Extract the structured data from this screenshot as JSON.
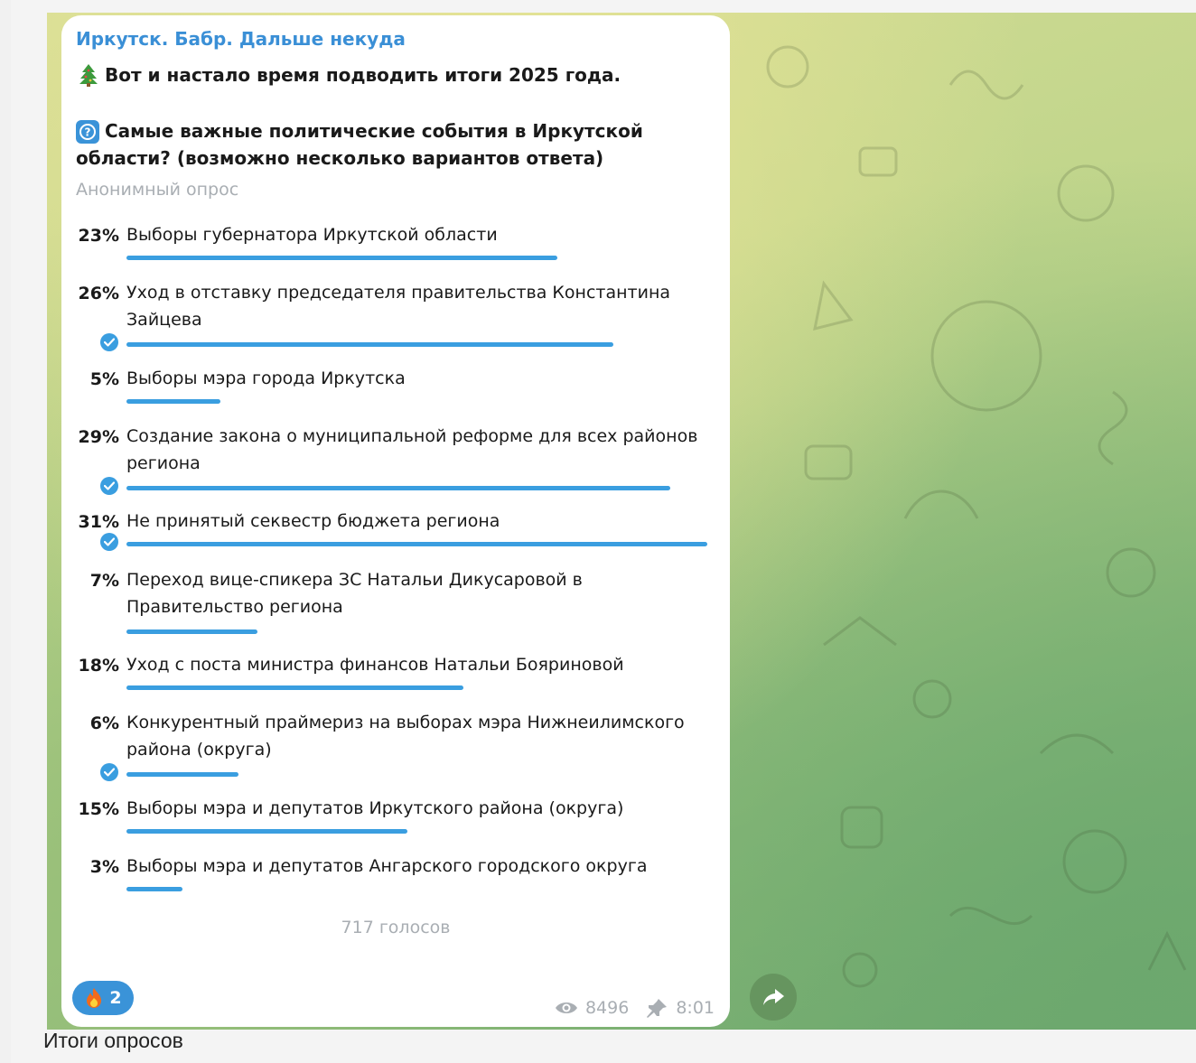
{
  "channel": {
    "name": "Иркутск. Бабр. Дальше некуда"
  },
  "post": {
    "headline": "Вот и настало время подводить итоги 2025 года.",
    "question": "Самые важные политические события в Иркутской области? (возможно несколько вариантов ответа)",
    "poll_type": "Анонимный опрос",
    "options": [
      {
        "pct": "23%",
        "value": 23,
        "text": "Выборы губернатора Иркутской области",
        "chosen": false
      },
      {
        "pct": "26%",
        "value": 26,
        "text": "Уход в отставку председателя правительства Константина Зайцева",
        "chosen": true
      },
      {
        "pct": "5%",
        "value": 5,
        "text": "Выборы мэра города Иркутска",
        "chosen": false
      },
      {
        "pct": "29%",
        "value": 29,
        "text": "Создание закона о муниципальной реформе для всех районов региона",
        "chosen": true
      },
      {
        "pct": "31%",
        "value": 31,
        "text": "Не принятый секвестр бюджета региона",
        "chosen": true
      },
      {
        "pct": "7%",
        "value": 7,
        "text": "Переход вице-спикера ЗС Натальи Дикусаровой в Правительство региона",
        "chosen": false
      },
      {
        "pct": "18%",
        "value": 18,
        "text": "Уход с поста министра финансов Натальи Бояриновой",
        "chosen": false
      },
      {
        "pct": "6%",
        "value": 6,
        "text": "Конкурентный праймериз на выборах мэра Нижнеилимского района (округа)",
        "chosen": true
      },
      {
        "pct": "15%",
        "value": 15,
        "text": "Выборы мэра и депутатов Иркутского района (округа)",
        "chosen": false
      },
      {
        "pct": "3%",
        "value": 3,
        "text": "Выборы мэра и депутатов Ангарского городского округа",
        "chosen": false
      }
    ],
    "votes": "717 голосов",
    "reaction": {
      "icon": "fire-icon",
      "count": "2"
    },
    "views": "8496",
    "time": "8:01"
  },
  "caption": "Итоги опросов",
  "colors": {
    "accent": "#3a9ee0",
    "channel": "#3a8fd6",
    "muted": "#a9aeb3"
  }
}
